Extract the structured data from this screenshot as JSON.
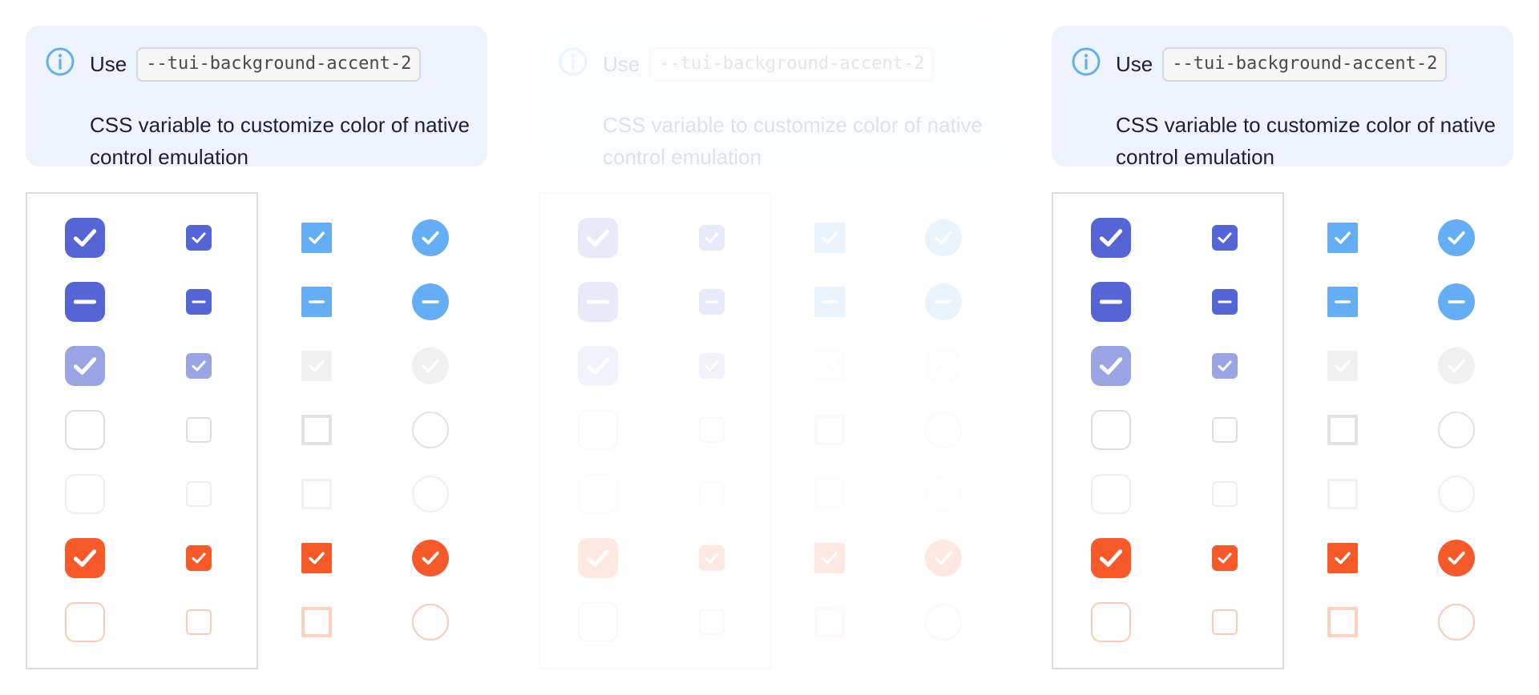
{
  "notice": {
    "prefix": "Use",
    "variable": "--tui-background-accent-2",
    "text": "CSS variable to customize color of native control emulation",
    "icon": "info-circle-icon"
  },
  "panels": [
    {
      "name": "light-panel",
      "state": "normal"
    },
    {
      "name": "faded-panel",
      "state": "faded"
    },
    {
      "name": "light-panel-2",
      "state": "normal"
    }
  ],
  "rows": [
    "checked",
    "indeterminate",
    "checked-disabled",
    "unchecked",
    "unchecked-disabled",
    "checked-error",
    "unchecked-error"
  ],
  "columns": [
    "checkbox-large",
    "checkbox-small",
    "native-checkbox",
    "native-radio"
  ],
  "colors": {
    "primary": "#5565d6",
    "primary_disabled": "#9ba4e4",
    "native_accent": "#63aef4",
    "error": "#f75a28",
    "notice_bg": "#edf4fd",
    "info_icon": "#65aef4"
  }
}
